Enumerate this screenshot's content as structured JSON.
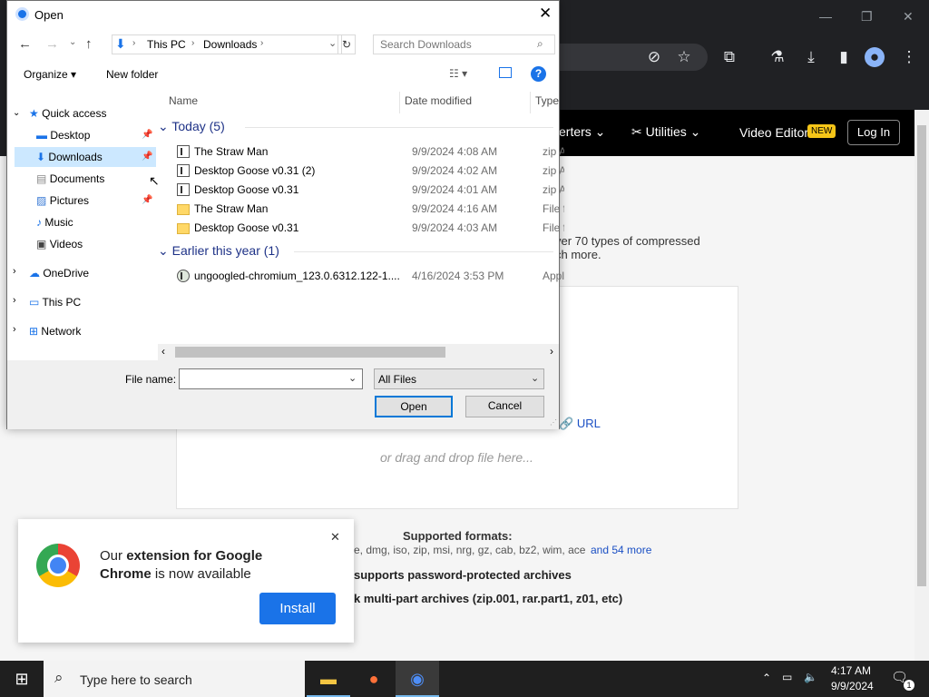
{
  "browser": {
    "win_minimize": "—",
    "win_restore": "❐",
    "win_close": "✕"
  },
  "site": {
    "nav": {
      "converters": "erters",
      "utilities": "Utilities",
      "video_editor": "Video Editor",
      "new_badge": "NEW",
      "login": "Log In"
    },
    "desc_line1": "ver 70 types of compressed",
    "desc_line2": "ch more.",
    "url_label": "URL",
    "drag_drop": "or drag and drop file here...",
    "supported_title": "Supported formats:",
    "formats": "e, dmg, iso, zip, msi, nrg, gz, cab, bz2, wim, ace",
    "more_link": "and 54 more",
    "feature1": "supports password-protected archives",
    "feature2": "k multi-part archives (zip.001, rar.part1, z01, etc)"
  },
  "popup": {
    "text_pre": "Our ",
    "text_bold1": "extension for Google",
    "text_bold2": "Chrome",
    "text_post": " is now available",
    "install": "Install",
    "close": "✕"
  },
  "dialog": {
    "title": "Open",
    "breadcrumb": [
      "This PC",
      "Downloads"
    ],
    "search_placeholder": "Search Downloads",
    "organize": "Organize",
    "new_folder": "New folder",
    "nav": {
      "quick_access": "Quick access",
      "desktop": "Desktop",
      "downloads": "Downloads",
      "documents": "Documents",
      "pictures": "Pictures",
      "music": "Music",
      "videos": "Videos",
      "onedrive": "OneDrive",
      "this_pc": "This PC",
      "network": "Network"
    },
    "columns": {
      "name": "Name",
      "date": "Date modified",
      "type": "Type"
    },
    "groups": {
      "today": "Today (5)",
      "earlier": "Earlier this year (1)"
    },
    "files_today": [
      {
        "name": "The Straw Man",
        "date": "9/9/2024 4:08 AM",
        "type": "zip A"
      },
      {
        "name": "Desktop Goose v0.31 (2)",
        "date": "9/9/2024 4:02 AM",
        "type": "zip A"
      },
      {
        "name": "Desktop Goose v0.31",
        "date": "9/9/2024 4:01 AM",
        "type": "zip A"
      },
      {
        "name": "The Straw Man",
        "date": "9/9/2024 4:16 AM",
        "type": "File fo"
      },
      {
        "name": "Desktop Goose v0.31",
        "date": "9/9/2024 4:03 AM",
        "type": "File fo"
      }
    ],
    "files_earlier": [
      {
        "name": "ungoogled-chromium_123.0.6312.122-1....",
        "date": "4/16/2024 3:53 PM",
        "type": "Appli"
      }
    ],
    "file_name_label": "File name:",
    "file_name_value": "",
    "filter": "All Files",
    "open_btn": "Open",
    "cancel_btn": "Cancel"
  },
  "taskbar": {
    "search_placeholder": "Type here to search",
    "time": "4:17 AM",
    "date": "9/9/2024",
    "notif_count": "1"
  }
}
